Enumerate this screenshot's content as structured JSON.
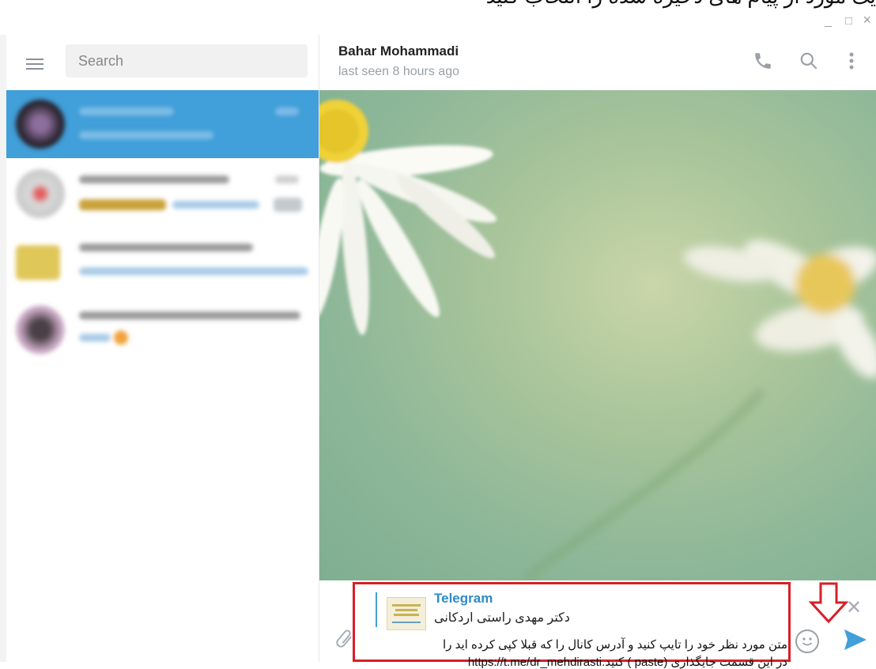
{
  "window": {
    "minimize": "_",
    "maximize": "□",
    "close": "×"
  },
  "top_strip_text": "یک مورد از پیام های ذخیره شده را انتخاب کنید",
  "sidebar": {
    "search_placeholder": "Search",
    "chats": [
      {
        "active": true
      },
      {
        "active": false
      },
      {
        "active": false
      },
      {
        "active": false
      }
    ]
  },
  "chat": {
    "name": "Bahar Mohammadi",
    "status": "last seen 8 hours ago"
  },
  "compose": {
    "forward_title": "Telegram",
    "forward_text": "دکتر مهدی راستی اردکانی",
    "message_line1": "متن مورد نظر خود را تایپ کنید و آدرس کانال را که قبلا کپی کرده اید را",
    "message_line2": "در این قسمت جایگذاری (paste ) کنید.https://t.me/dr_mehdirasti"
  },
  "colors": {
    "accent": "#419fd9",
    "annotation_red": "#d71f28"
  }
}
